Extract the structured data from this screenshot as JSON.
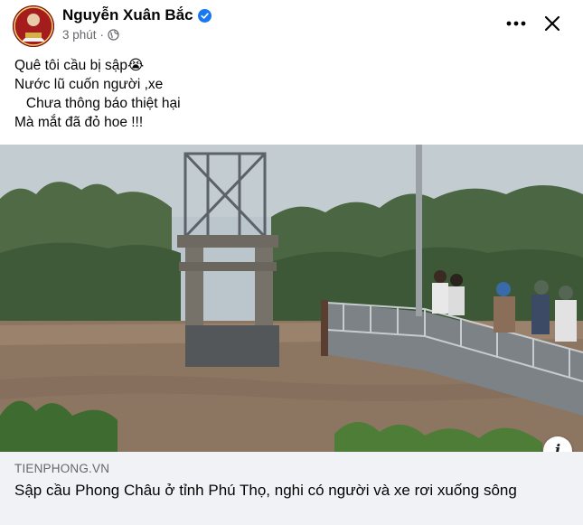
{
  "post": {
    "author_name": "Nguyễn Xuân Bắc",
    "time": "3 phút",
    "separator": "·",
    "icons": {
      "verified": "verified-badge-icon",
      "privacy": "globe-icon",
      "more": "more-horizontal-icon",
      "close": "close-icon"
    },
    "text_lines": [
      "Quê tôi cầu bị sập😭",
      "Nước lũ cuốn người ,xe",
      "   Chưa thông báo thiệt hại",
      "Mà mắt đã đỏ hoe !!!"
    ]
  },
  "link_preview": {
    "domain": "TIENPHONG.VN",
    "title": "Sập cầu Phong Châu ở tỉnh Phú Thọ, nghi có người và xe rơi xuống sông",
    "info_label": "i"
  },
  "colors": {
    "verified": "#1877f2",
    "secondary_text": "#65676b",
    "link_box_bg": "#f0f2f5"
  }
}
